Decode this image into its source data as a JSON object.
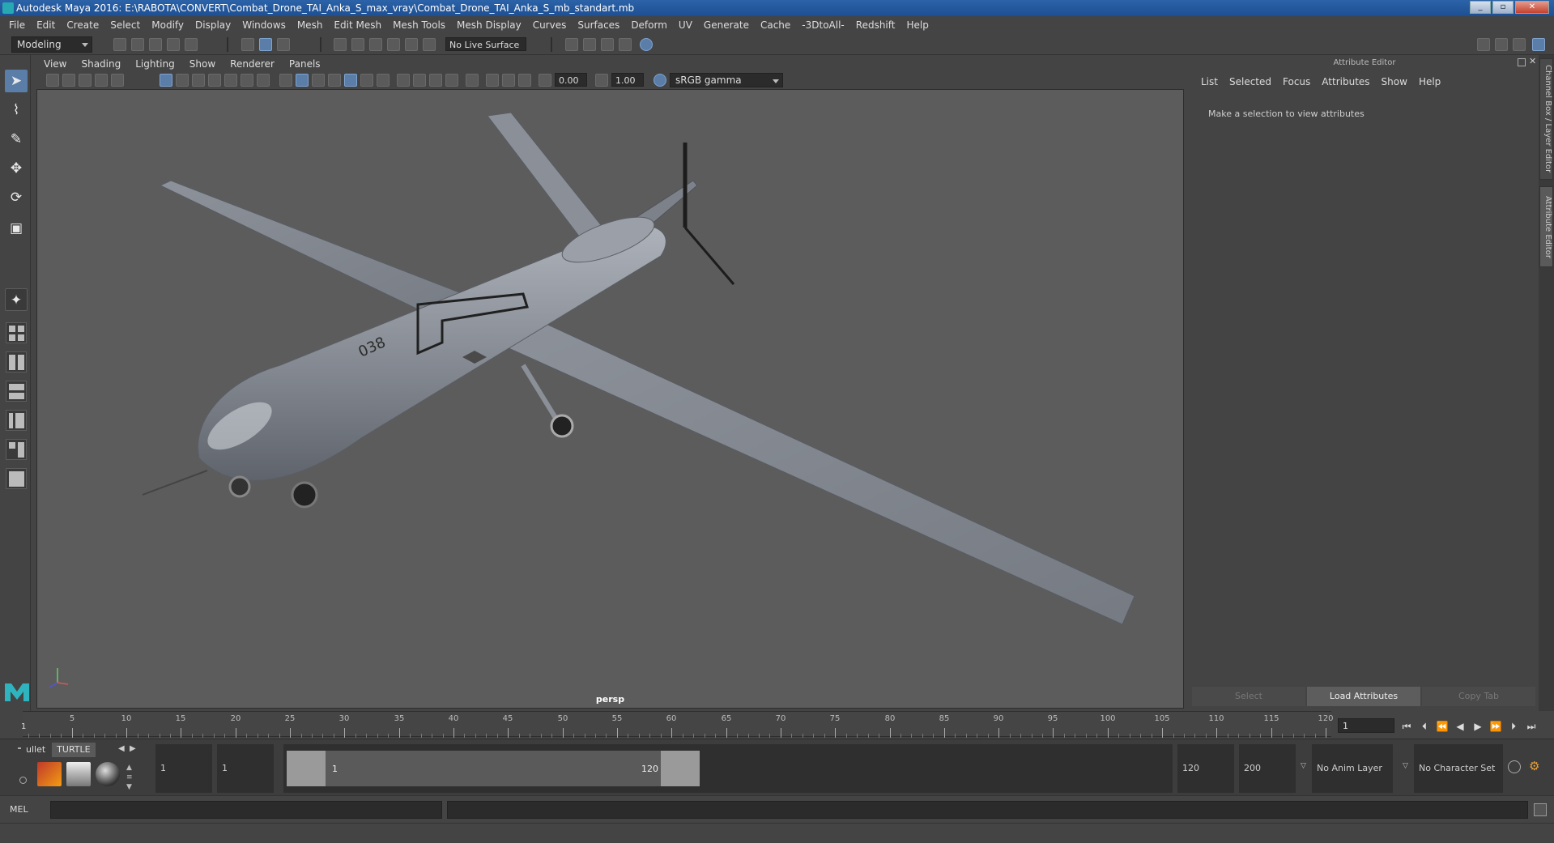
{
  "window": {
    "title": "Autodesk Maya 2016: E:\\RABOTA\\CONVERT\\Combat_Drone_TAI_Anka_S_max_vray\\Combat_Drone_TAI_Anka_S_mb_standart.mb"
  },
  "main_menu": [
    "File",
    "Edit",
    "Create",
    "Select",
    "Modify",
    "Display",
    "Windows",
    "Mesh",
    "Edit Mesh",
    "Mesh Tools",
    "Mesh Display",
    "Curves",
    "Surfaces",
    "Deform",
    "UV",
    "Generate",
    "Cache",
    "-3DtoAll-",
    "Redshift",
    "Help"
  ],
  "status_line": {
    "menu_set": "Modeling",
    "live_surface": "No Live Surface"
  },
  "viewport": {
    "menu": [
      "View",
      "Shading",
      "Lighting",
      "Show",
      "Renderer",
      "Panels"
    ],
    "exposure": "0.00",
    "gamma": "1.00",
    "color_space": "sRGB gamma",
    "camera_label": "persp",
    "model_tail_number": "038"
  },
  "attribute_editor": {
    "title": "Attribute Editor",
    "menu": [
      "List",
      "Selected",
      "Focus",
      "Attributes",
      "Show",
      "Help"
    ],
    "message": "Make a selection to view attributes",
    "buttons": {
      "select": "Select",
      "load": "Load Attributes",
      "copy": "Copy Tab"
    }
  },
  "side_tabs": {
    "channel_box": "Channel Box / Layer Editor",
    "attribute_editor": "Attribute Editor"
  },
  "time_slider": {
    "start_marker": "1",
    "ticks": [
      "5",
      "10",
      "15",
      "20",
      "25",
      "30",
      "35",
      "40",
      "45",
      "50",
      "55",
      "60",
      "65",
      "70",
      "75",
      "80",
      "85",
      "90",
      "95",
      "100",
      "105",
      "110",
      "115",
      "120"
    ],
    "current_frame": "1"
  },
  "range": {
    "start": "1",
    "playback_start": "1",
    "range_start_label": "1",
    "range_end_label": "120",
    "playback_end": "120",
    "end": "200",
    "anim_layer": "No Anim Layer",
    "character_set": "No Character Set"
  },
  "shelf": {
    "tabs": [
      "ullet",
      "TURTLE"
    ]
  },
  "command_line": {
    "language": "MEL"
  }
}
